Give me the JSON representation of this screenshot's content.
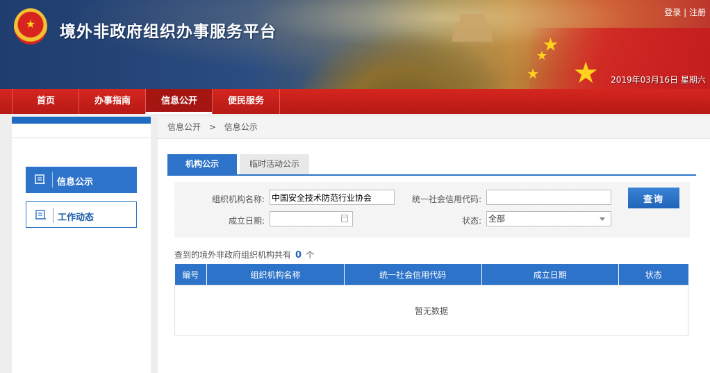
{
  "header": {
    "site_title": "境外非政府组织办事服务平台",
    "login": "登录",
    "separator": "|",
    "register": "注册",
    "date": "2019年03月16日 星期六",
    "emblem_icon": "national-emblem-icon"
  },
  "nav": {
    "items": [
      {
        "label": "首页"
      },
      {
        "label": "办事指南"
      },
      {
        "label": "信息公开",
        "active": true
      },
      {
        "label": "便民服务"
      }
    ]
  },
  "sidebar": {
    "items": [
      {
        "label": "信息公示",
        "active": true,
        "icon": "document-icon"
      },
      {
        "label": "工作动态",
        "active": false,
        "icon": "document-icon"
      }
    ]
  },
  "breadcrumb": {
    "parent": "信息公开",
    "separator": ">",
    "current": "信息公示"
  },
  "tabs": [
    {
      "label": "机构公示",
      "active": true
    },
    {
      "label": "临时活动公示",
      "active": false
    }
  ],
  "form": {
    "org_name_label": "组织机构名称:",
    "org_name_value": "中国安全技术防范行业协会",
    "credit_code_label": "统一社会信用代码:",
    "credit_code_value": "",
    "date_label": "成立日期:",
    "date_value": "",
    "status_label": "状态:",
    "status_value": "全部",
    "query_button": "查询"
  },
  "result": {
    "prefix": "查到的境外非政府组织机构共有",
    "count": "0",
    "suffix": "个"
  },
  "table": {
    "columns": [
      "编号",
      "组织机构名称",
      "统一社会信用代码",
      "成立日期",
      "状态"
    ],
    "empty_text": "暂无数据"
  },
  "colors": {
    "primary_blue": "#2c73c9",
    "nav_red": "#c41e1e",
    "header_navy": "#1f3d6e"
  }
}
